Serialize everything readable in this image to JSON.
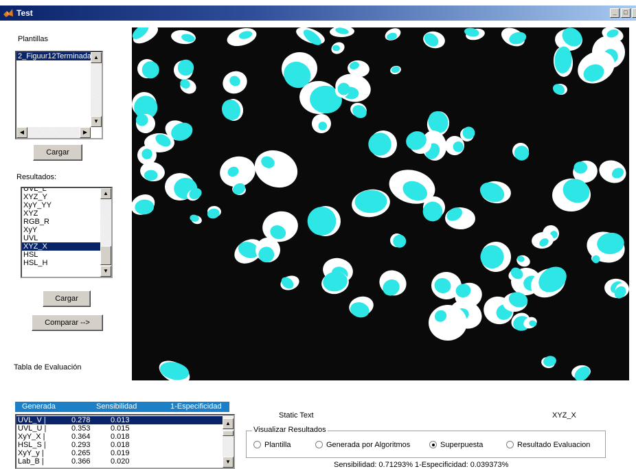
{
  "window": {
    "title": "Test",
    "minimize_glyph": "_",
    "maximize_glyph": "□"
  },
  "left_panel": {
    "plantillas_label": "Plantillas",
    "plantillas_items": [
      "2_Figuur12Terminada"
    ],
    "plantillas_selected": 0,
    "cargar1_label": "Cargar",
    "resultados_label": "Resultados:",
    "resultados_items": [
      "UVL_L",
      "XYZ_Y",
      "XyY_YY",
      "XYZ",
      "RGB_R",
      "XyY",
      "UVL",
      "XYZ_X",
      "HSL",
      "HSL_H"
    ],
    "resultados_selected": 7,
    "cargar2_label": "Cargar",
    "comparar_label": "Comparar -->",
    "tabla_label": "Tabla de Evaluación"
  },
  "eval_table": {
    "headers": [
      "Generada",
      "Sensibilidad",
      "1-Especificidad"
    ],
    "rows": [
      {
        "name": "UVL_V  |",
        "sens": "0.278",
        "spec": "0.013"
      },
      {
        "name": "UVL_U  |",
        "sens": "0.353",
        "spec": "0.015"
      },
      {
        "name": "XyY_X  |",
        "sens": "0.364",
        "spec": "0.018"
      },
      {
        "name": "HSL_S  |",
        "sens": "0.293",
        "spec": "0.018"
      },
      {
        "name": "XyY_y  |",
        "sens": "0.265",
        "spec": "0.019"
      },
      {
        "name": "Lab_B  |",
        "sens": "0.366",
        "spec": "0.020"
      }
    ],
    "selected": 0
  },
  "bottom": {
    "static_text": "Static Text",
    "current_label": "XYZ_X",
    "group_title": "Visualizar Resultados",
    "radios": [
      {
        "label": "Plantilla",
        "checked": false
      },
      {
        "label": "Generada por Algoritmos",
        "checked": false
      },
      {
        "label": "Superpuesta",
        "checked": true
      },
      {
        "label": "Resultado Evaluacion",
        "checked": false
      }
    ],
    "metrics_text": "Sensibilidad:  0.71293% 1-Especificidad:      0.039373%"
  },
  "colors": {
    "title_start": "#0a246a",
    "image_bg": "#0a0a0a",
    "blob_white": "#ffffff",
    "blob_cyan": "#2ee6e6",
    "header_blue": "#1d7fc6"
  },
  "icons": {
    "app": "matlab-logo-icon",
    "scroll_up": "arrow-up-icon",
    "scroll_down": "arrow-down-icon",
    "scroll_left": "arrow-left-icon",
    "scroll_right": "arrow-right-icon"
  }
}
